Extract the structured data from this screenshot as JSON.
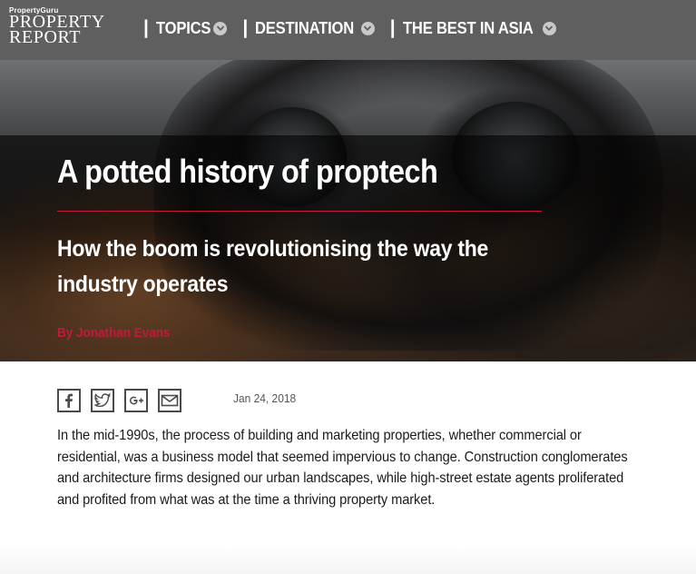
{
  "header": {
    "logo": {
      "brand": "PropertyGuru",
      "line1": "PROPERTY",
      "line2": "REPORT"
    },
    "nav": [
      {
        "label": "TOPICS",
        "icon": "chevron-down-icon"
      },
      {
        "label": "DESTINATION",
        "icon": "chevron-down-icon"
      },
      {
        "label": "THE BEST IN ASIA",
        "icon": "chevron-down-icon"
      }
    ],
    "separator": "|"
  },
  "hero": {
    "title": "A potted history of proptech",
    "subtitle": "How the boom is revolutionising the way the industry operates",
    "byline": "By Jonathan Evans",
    "accent_color": "#c4193d"
  },
  "share": {
    "icons": [
      "facebook-icon",
      "twitter-icon",
      "google-plus-icon",
      "email-icon"
    ]
  },
  "article": {
    "date": "Jan 24, 2018",
    "intro": "In the mid-1990s, the process of building and marketing properties, whether commercial or residential, was a business model that seemed impervious to change. Construction conglomerates and architecture firms designed our urban landscapes, while high-street estate agents proliferated and profited from what was at the time a thriving property market."
  },
  "colors": {
    "topbar": "#5f5f5f",
    "text": "#1a1a1a",
    "accent": "#c4193d"
  }
}
